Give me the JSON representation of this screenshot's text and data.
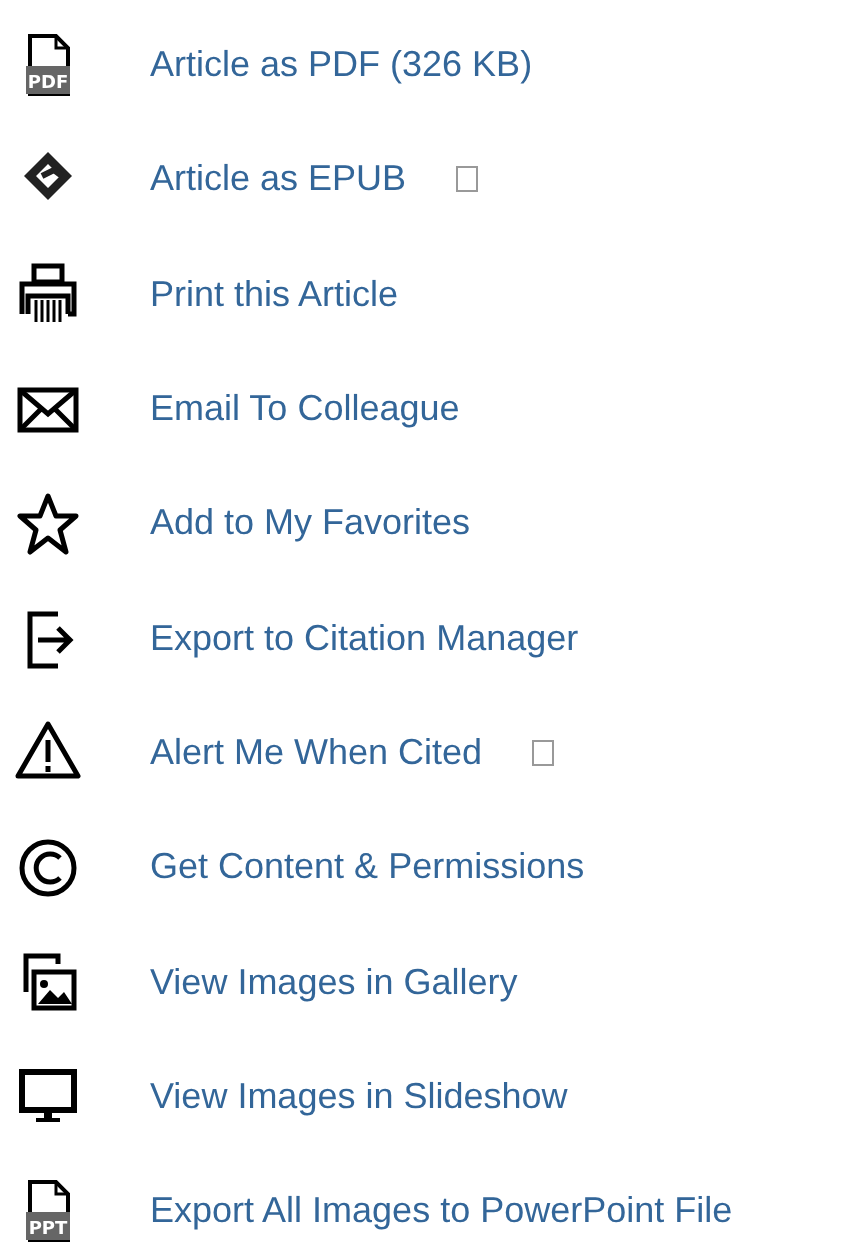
{
  "links": [
    {
      "kind": "pdf",
      "icon_text": "PDF",
      "label": "Article as PDF (326 KB)",
      "external_mark": false
    },
    {
      "kind": "epub",
      "label": "Article as EPUB",
      "external_mark": true
    },
    {
      "kind": "print",
      "label": "Print this Article",
      "external_mark": false
    },
    {
      "kind": "email",
      "label": "Email To Colleague",
      "external_mark": false
    },
    {
      "kind": "star",
      "label": "Add to My Favorites",
      "external_mark": false
    },
    {
      "kind": "export",
      "label": "Export to Citation Manager",
      "external_mark": false
    },
    {
      "kind": "alert",
      "label": "Alert Me When Cited",
      "external_mark": true
    },
    {
      "kind": "copyright",
      "label": "Get Content & Permissions",
      "external_mark": false
    },
    {
      "kind": "gallery",
      "label": "View Images in Gallery",
      "external_mark": false
    },
    {
      "kind": "slideshow",
      "label": "View Images in Slideshow",
      "external_mark": false
    },
    {
      "kind": "ppt",
      "icon_text": "PPT",
      "label": "Export All Images to PowerPoint File",
      "external_mark": false
    }
  ]
}
